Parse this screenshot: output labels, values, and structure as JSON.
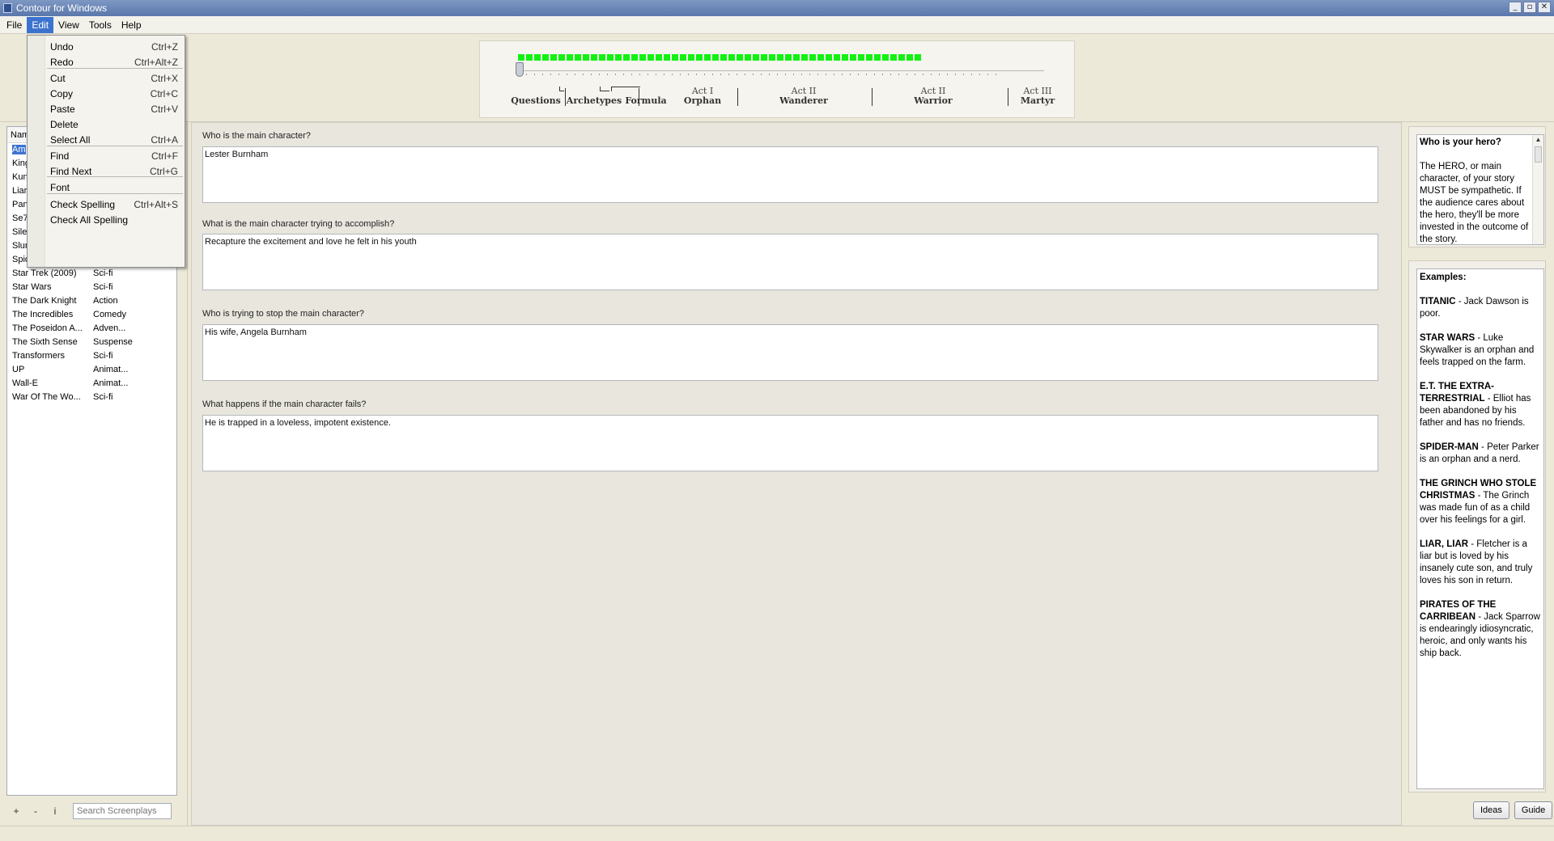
{
  "window": {
    "title": "Contour for Windows",
    "controls": [
      "_",
      "▫",
      "✕"
    ]
  },
  "menubar": {
    "items": [
      "File",
      "Edit",
      "View",
      "Tools",
      "Help"
    ],
    "active": "Edit"
  },
  "edit_menu": {
    "items": [
      {
        "label": "Undo",
        "shortcut": "Ctrl+Z"
      },
      {
        "label": "Redo",
        "shortcut": "Ctrl+Alt+Z"
      },
      {
        "label": "Cut",
        "shortcut": "Ctrl+X"
      },
      {
        "label": "Copy",
        "shortcut": "Ctrl+C"
      },
      {
        "label": "Paste",
        "shortcut": "Ctrl+V"
      },
      {
        "label": "Delete",
        "shortcut": ""
      },
      {
        "label": "Select All",
        "shortcut": "Ctrl+A"
      },
      {
        "label": "Find",
        "shortcut": "Ctrl+F"
      },
      {
        "label": "Find Next",
        "shortcut": "Ctrl+G"
      },
      {
        "label": "Font",
        "shortcut": ""
      },
      {
        "label": "Check Spelling",
        "shortcut": "Ctrl+Alt+S"
      },
      {
        "label": "Check All Spelling",
        "shortcut": ""
      }
    ]
  },
  "progress": {
    "completed_blocks": 50,
    "acts": [
      {
        "top": "",
        "bottom": "Questions"
      },
      {
        "top": "",
        "bottom": "Archetypes"
      },
      {
        "top": "",
        "bottom": "Formula"
      },
      {
        "top": "Act I",
        "bottom": "Orphan"
      },
      {
        "top": "Act II",
        "bottom": "Wanderer"
      },
      {
        "top": "Act II",
        "bottom": "Warrior"
      },
      {
        "top": "Act III",
        "bottom": "Martyr"
      }
    ]
  },
  "screenplays": {
    "header": {
      "name": "Nam",
      "genre": ""
    },
    "rows": [
      {
        "name": "Am",
        "genre": ""
      },
      {
        "name": "King",
        "genre": ""
      },
      {
        "name": "Kun",
        "genre": ""
      },
      {
        "name": "Liar",
        "genre": ""
      },
      {
        "name": "Pan",
        "genre": ""
      },
      {
        "name": "Se7",
        "genre": ""
      },
      {
        "name": "Sile",
        "genre": ""
      },
      {
        "name": "Slur",
        "genre": ""
      },
      {
        "name": "Spid",
        "genre": ""
      },
      {
        "name": "Star Trek (2009)",
        "genre": "Sci-fi"
      },
      {
        "name": "Star Wars",
        "genre": "Sci-fi"
      },
      {
        "name": "The Dark Knight",
        "genre": "Action"
      },
      {
        "name": "The Incredibles",
        "genre": "Comedy"
      },
      {
        "name": "The Poseidon A...",
        "genre": "Adven..."
      },
      {
        "name": "The Sixth Sense",
        "genre": "Suspense"
      },
      {
        "name": "Transformers",
        "genre": "Sci-fi"
      },
      {
        "name": "UP",
        "genre": "Animat..."
      },
      {
        "name": "Wall-E",
        "genre": "Animat..."
      },
      {
        "name": "War Of The Wo...",
        "genre": "Sci-fi"
      }
    ],
    "buttons": {
      "add": "+",
      "remove": "-",
      "info": "i"
    },
    "search_placeholder": "Search Screenplays"
  },
  "questions": [
    {
      "label": "Who is the main character?",
      "answer": "Lester Burnham"
    },
    {
      "label": "What is the main character trying to accomplish?",
      "answer": "Recapture the excitement and love he felt in his youth"
    },
    {
      "label": "Who is trying to stop the main character?",
      "answer": "His wife, Angela Burnham"
    },
    {
      "label": "What happens if the main character fails?",
      "answer": "He is trapped in a loveless, impotent existence."
    }
  ],
  "help": {
    "title": "Who is your hero?",
    "body": "The HERO, or main character, of your story MUST be sympathetic. If the audience cares about the hero, they'll be more invested in the outcome of the story."
  },
  "examples": {
    "title": "Examples:",
    "items": [
      {
        "title": "TITANIC",
        "text": " - Jack Dawson is poor."
      },
      {
        "title": "STAR WARS",
        "text": " - Luke Skywalker is an orphan and feels trapped on the farm."
      },
      {
        "title": "E.T. THE EXTRA-TERRESTRIAL",
        "text": " - Elliot has been abandoned by his father and has no friends."
      },
      {
        "title": "SPIDER-MAN",
        "text": " - Peter Parker is an orphan and a nerd."
      },
      {
        "title": "THE GRINCH WHO STOLE CHRISTMAS",
        "text": " - The Grinch was made fun of as a child over his feelings for a girl."
      },
      {
        "title": "LIAR, LIAR",
        "text": " - Fletcher is a liar but is loved by his insanely cute son, and truly loves his son in return."
      },
      {
        "title": "PIRATES OF THE CARRIBEAN",
        "text": " - Jack Sparrow is endearingly idiosyncratic, heroic, and only wants his ship back."
      }
    ]
  },
  "right_buttons": {
    "ideas": "Ideas",
    "guide": "Guide"
  },
  "colors": {
    "progress_block": "#12f212",
    "selection": "#3c73cf"
  }
}
